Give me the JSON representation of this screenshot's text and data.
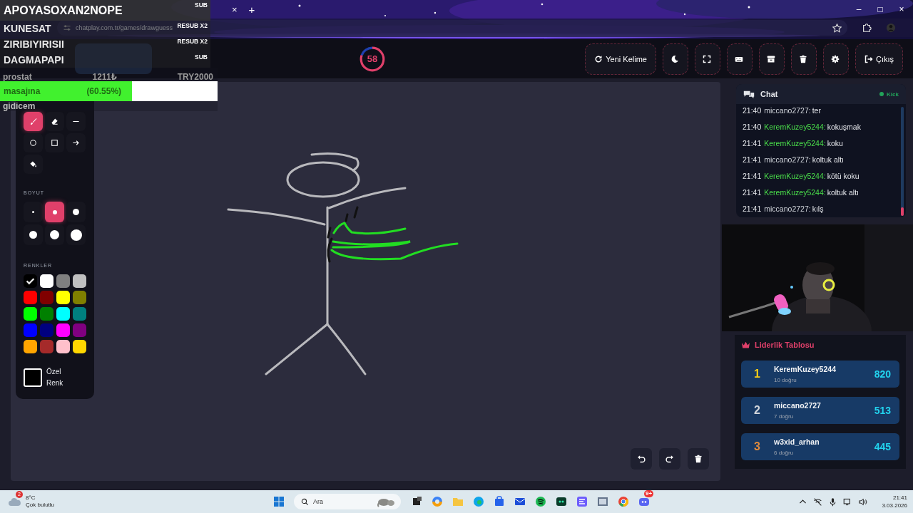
{
  "browser": {
    "tab_close": "×",
    "new_tab": "+",
    "url": "chatplay.com.tr/games/drawguess",
    "window_controls": [
      "–",
      "□",
      "×"
    ]
  },
  "overlay": {
    "subs": [
      {
        "name": "APOYASOXAN2NOPE",
        "badge": "SUB"
      },
      {
        "name": "KUNESAT",
        "badge": "RESUB X2"
      },
      {
        "name": "ZIRIBIYIRISII",
        "badge": "RESUB X2"
      },
      {
        "name": "DAGMAPAPI",
        "badge": "SUB"
      }
    ],
    "donation": {
      "donor": "prostat",
      "amount": "1211₺",
      "goal": "TRY2000",
      "message": "masajına",
      "percent": "(60.55%)",
      "level": 0.6055,
      "message_end": "gidicem"
    }
  },
  "timer": {
    "value": "58",
    "level": 0.8
  },
  "toolbar": [
    {
      "kind": "refresh",
      "label": "Yeni Kelime"
    },
    {
      "kind": "moon"
    },
    {
      "kind": "fullscreen"
    },
    {
      "kind": "keyboard"
    },
    {
      "kind": "archive"
    },
    {
      "kind": "trash"
    },
    {
      "kind": "gear"
    },
    {
      "kind": "logout",
      "label": "Çıkış"
    }
  ],
  "tools": [
    {
      "kind": "brush",
      "selected": true
    },
    {
      "kind": "eraser",
      "selected": false
    },
    {
      "kind": "line",
      "selected": false
    },
    {
      "kind": "circle",
      "selected": false
    },
    {
      "kind": "square",
      "selected": false
    },
    {
      "kind": "arrow",
      "selected": false
    },
    {
      "kind": "fill",
      "selected": false
    }
  ],
  "size_title": "BOYUT",
  "sizes": [
    {
      "kind": "xs",
      "selected": false
    },
    {
      "kind": "s",
      "selected": true
    },
    {
      "kind": "m",
      "selected": false
    },
    {
      "kind": "l",
      "selected": false
    },
    {
      "kind": "xl",
      "selected": false
    },
    {
      "kind": "xxl",
      "selected": false
    }
  ],
  "colors_title": "RENKLER",
  "colors": [
    {
      "color": "#000000",
      "selected": true
    },
    {
      "color": "#ffffff",
      "selected": false
    },
    {
      "color": "#808080",
      "selected": false
    },
    {
      "color": "#c0c0c0",
      "selected": false
    },
    {
      "color": "#ff0000",
      "selected": false
    },
    {
      "color": "#800000",
      "selected": false
    },
    {
      "color": "#ffff00",
      "selected": false
    },
    {
      "color": "#808000",
      "selected": false
    },
    {
      "color": "#00ff00",
      "selected": false
    },
    {
      "color": "#008000",
      "selected": false
    },
    {
      "color": "#00ffff",
      "selected": false
    },
    {
      "color": "#008080",
      "selected": false
    },
    {
      "color": "#0000ff",
      "selected": false
    },
    {
      "color": "#000080",
      "selected": false
    },
    {
      "color": "#ff00ff",
      "selected": false
    },
    {
      "color": "#800080",
      "selected": false
    },
    {
      "color": "#ffa500",
      "selected": false
    },
    {
      "color": "#a52a2a",
      "selected": false
    },
    {
      "color": "#ffc0cb",
      "selected": false
    },
    {
      "color": "#ffd700",
      "selected": false
    }
  ],
  "custom_color": {
    "label": "Özel Renk",
    "color": "#000000"
  },
  "chat": {
    "title": "Chat",
    "platform": "Kick",
    "messages": [
      {
        "time": "21:40",
        "user": "miccano2727:",
        "correct": false,
        "text": "ter"
      },
      {
        "time": "21:40",
        "user": "KeremKuzey5244:",
        "correct": true,
        "text": "kokuşmak"
      },
      {
        "time": "21:41",
        "user": "KeremKuzey5244:",
        "correct": true,
        "text": "koku"
      },
      {
        "time": "21:41",
        "user": "miccano2727:",
        "correct": false,
        "text": "koltuk altı"
      },
      {
        "time": "21:41",
        "user": "KeremKuzey5244:",
        "correct": true,
        "text": "kötü koku"
      },
      {
        "time": "21:41",
        "user": "KeremKuzey5244:",
        "correct": true,
        "text": "koltuk altı"
      },
      {
        "time": "21:41",
        "user": "miccano2727:",
        "correct": false,
        "text": "kılş"
      }
    ]
  },
  "leaderboard": {
    "title": "Liderlik Tablosu",
    "entries": [
      {
        "rank": "1",
        "color": "#facc15",
        "name": "KeremKuzey5244",
        "detail": "10 doğru",
        "score": "820"
      },
      {
        "rank": "2",
        "color": "#d1d5db",
        "name": "miccano2727",
        "detail": "7 doğru",
        "score": "513"
      },
      {
        "rank": "3",
        "color": "#e08a3c",
        "name": "w3xid_arhan",
        "detail": "6 doğru",
        "score": "445"
      }
    ]
  },
  "taskbar": {
    "weather_badge": "2",
    "temperature": "8°C",
    "weather": "Çok bulutlu",
    "search_placeholder": "Ara",
    "discord_badge": "9+",
    "time": "21:41",
    "date": "3.03.2026"
  }
}
